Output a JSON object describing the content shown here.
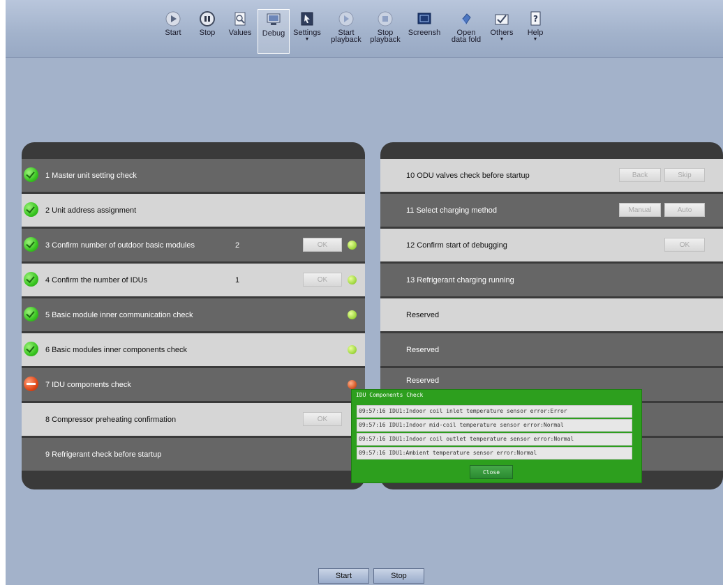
{
  "toolbar": {
    "items": [
      {
        "label": "Start",
        "icon": "start-icon"
      },
      {
        "label": "Stop",
        "icon": "stop-icon"
      },
      {
        "label": "Values",
        "icon": "values-icon"
      },
      {
        "label": "Debug",
        "icon": "debug-icon"
      },
      {
        "label": "Settings",
        "icon": "settings-icon"
      },
      {
        "label": "Start\nplayback",
        "icon": "start-playback-icon"
      },
      {
        "label": "Stop\nplayback",
        "icon": "stop-playback-icon"
      },
      {
        "label": "Screensh",
        "icon": "screenshot-icon"
      },
      {
        "label": "Open\ndata fold",
        "icon": "open-folder-icon"
      },
      {
        "label": "Others",
        "icon": "others-icon"
      },
      {
        "label": "Help",
        "icon": "help-icon"
      }
    ],
    "dropdown_arrow": "▼"
  },
  "left_steps": [
    {
      "label": "1 Master unit setting check",
      "status": "ok"
    },
    {
      "label": "2 Unit address assignment",
      "status": "ok"
    },
    {
      "label": "3 Confirm number of outdoor basic modules",
      "status": "ok",
      "count": "2",
      "button": "OK"
    },
    {
      "label": "4 Confirm the number of IDUs",
      "status": "ok",
      "count": "1",
      "button": "OK"
    },
    {
      "label": "5 Basic module inner communication check",
      "status": "ok"
    },
    {
      "label": "6 Basic modules inner components check",
      "status": "ok"
    },
    {
      "label": "7 IDU components check",
      "status": "error"
    },
    {
      "label": "8 Compressor preheating confirmation",
      "button": "OK"
    },
    {
      "label": "9 Refrigerant check before startup"
    }
  ],
  "right_steps": [
    {
      "label": "10 ODU valves check before startup",
      "buttons": [
        "Back",
        "Skip"
      ]
    },
    {
      "label": "11 Select charging method",
      "buttons": [
        "Manual",
        "Auto"
      ]
    },
    {
      "label": "12 Confirm start of debugging",
      "buttons": [
        "OK"
      ]
    },
    {
      "label": "13 Refrigerant charging running"
    },
    {
      "label": "Reserved"
    },
    {
      "label": "Reserved"
    },
    {
      "label": "Reserved"
    }
  ],
  "dialog": {
    "title": "IDU Components Check",
    "lines": [
      "09:57:16 IDU1:Indoor coil inlet temperature sensor error:Error",
      "09:57:16 IDU1:Indoor mid-coil temperature sensor error:Normal",
      "09:57:16 IDU1:Indoor coil outlet temperature sensor error:Normal",
      "09:57:16 IDU1:Ambient temperature sensor error:Normal"
    ],
    "close_label": "Close"
  },
  "bottom": {
    "start_label": "Start",
    "stop_label": "Stop"
  },
  "colors": {
    "background": "#a3b2ca",
    "panel": "#3a3a3a",
    "dialog": "#2d9f1e",
    "ok": "#38c520",
    "error": "#e04818"
  }
}
